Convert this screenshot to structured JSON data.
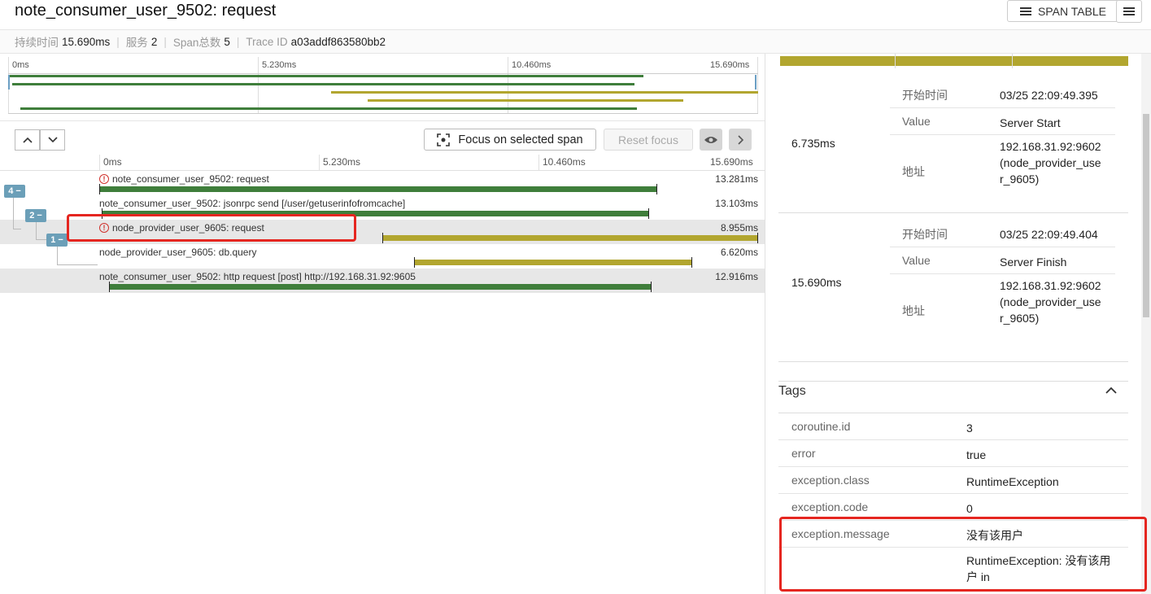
{
  "header": {
    "title": "note_consumer_user_9502: request",
    "span_table_label": "SPAN TABLE",
    "summary": {
      "duration_key": "持续时间",
      "duration_val": "15.690ms",
      "services_key": "服务",
      "services_val": "2",
      "spans_key": "Span总数",
      "spans_val": "5",
      "trace_key": "Trace ID",
      "trace_val": "a03addf863580bb2"
    }
  },
  "minimap": {
    "ticks": [
      "0ms",
      "5.230ms",
      "10.460ms",
      "15.690ms"
    ],
    "bars": [
      {
        "start": 0.0,
        "end": 13.281,
        "color": "#3f7e3b"
      },
      {
        "start": 0.05,
        "end": 13.103,
        "color": "#3f7e3b"
      },
      {
        "start": 6.735,
        "end": 15.69,
        "color": "#b2a62f"
      },
      {
        "start": 7.5,
        "end": 14.12,
        "color": "#b2a62f"
      },
      {
        "start": 0.23,
        "end": 13.146,
        "color": "#3f7e3b"
      }
    ]
  },
  "controls": {
    "focus_label": "Focus on selected span",
    "reset_label": "Reset focus"
  },
  "timeline": {
    "ticks": [
      "0ms",
      "5.230ms",
      "10.460ms",
      "15.690ms"
    ],
    "total_ms": 15.69,
    "rows": [
      {
        "name": "note_consumer_user_9502: request",
        "duration": "13.281ms",
        "start": 0.0,
        "end": 13.281,
        "error": true,
        "color": "#3f7e3b",
        "badge": "4 −"
      },
      {
        "name": "note_consumer_user_9502: jsonrpc send [/user/getuserinfofromcache]",
        "duration": "13.103ms",
        "start": 0.05,
        "end": 13.103,
        "error": false,
        "color": "#3f7e3b",
        "badge": "2 −"
      },
      {
        "name": "node_provider_user_9605: request",
        "duration": "8.955ms",
        "start": 6.735,
        "end": 15.69,
        "error": true,
        "color": "#b2a62f",
        "badge": "1 −"
      },
      {
        "name": "node_provider_user_9605: db.query",
        "duration": "6.620ms",
        "start": 7.5,
        "end": 14.12,
        "error": false,
        "color": "#b2a62f",
        "badge": ""
      },
      {
        "name": "note_consumer_user_9502: http request [post] http://192.168.31.92:9605",
        "duration": "12.916ms",
        "start": 0.23,
        "end": 13.146,
        "error": false,
        "color": "#3f7e3b",
        "badge": ""
      }
    ]
  },
  "logs": [
    {
      "time": "6.735ms",
      "fields": [
        {
          "key": "开始时间",
          "value": "03/25 22:09:49.395"
        },
        {
          "key": "Value",
          "value": "Server Start"
        },
        {
          "key": "地址",
          "value": "192.168.31.92:9602(node_provider_user_9605)"
        }
      ]
    },
    {
      "time": "15.690ms",
      "fields": [
        {
          "key": "开始时间",
          "value": "03/25 22:09:49.404"
        },
        {
          "key": "Value",
          "value": "Server Finish"
        },
        {
          "key": "地址",
          "value": "192.168.31.92:9602(node_provider_user_9605)"
        }
      ]
    }
  ],
  "tags": {
    "title": "Tags",
    "rows": [
      {
        "key": "coroutine.id",
        "value": "3"
      },
      {
        "key": "error",
        "value": "true"
      },
      {
        "key": "exception.class",
        "value": "RuntimeException"
      },
      {
        "key": "exception.code",
        "value": "0"
      },
      {
        "key": "exception.message",
        "value": "没有该用户"
      },
      {
        "key": "",
        "value": "RuntimeException: 没有该用户 in"
      }
    ]
  }
}
